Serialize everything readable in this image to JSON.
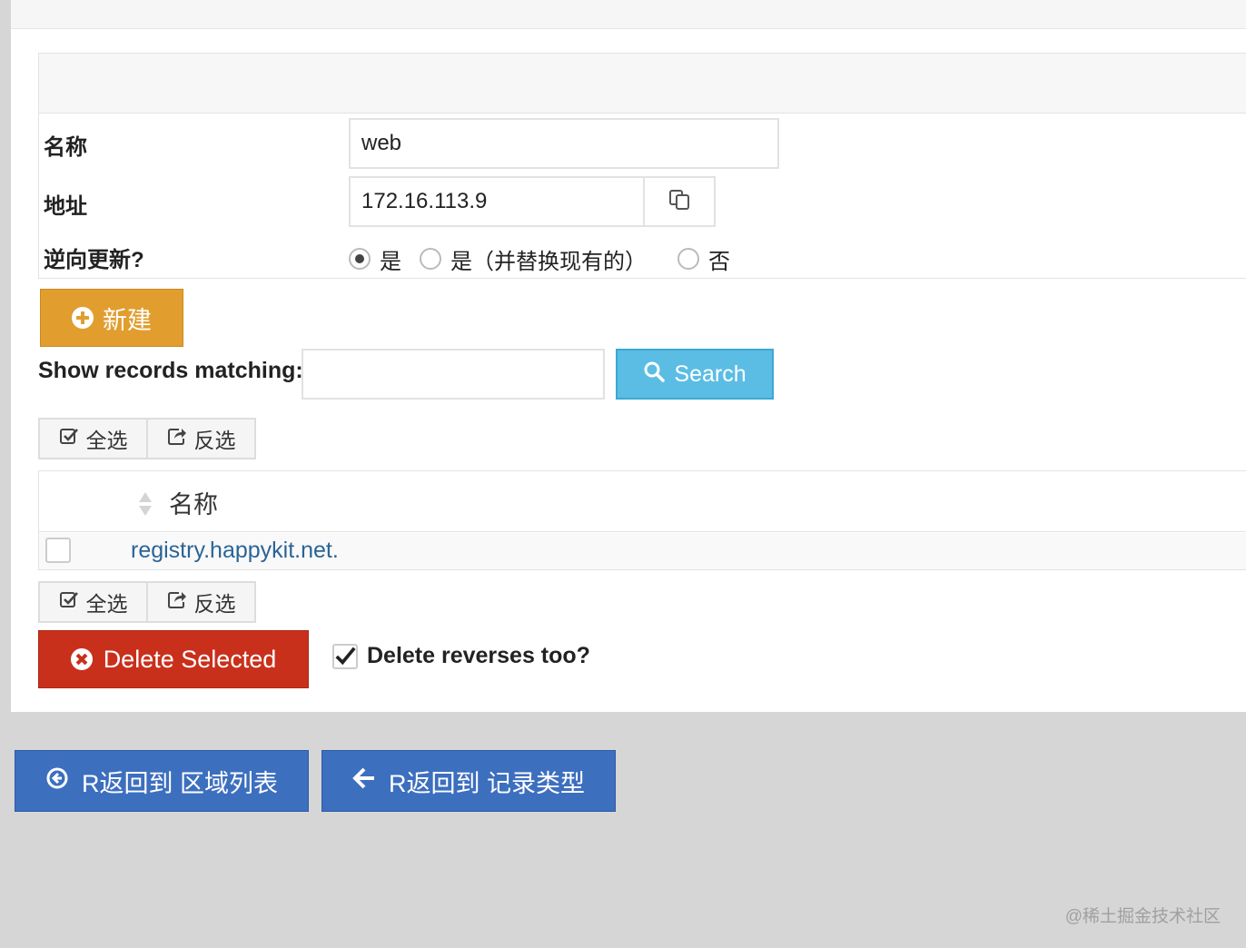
{
  "form": {
    "name_label": "名称",
    "name_value": "web",
    "address_label": "地址",
    "address_value": "172.16.113.9",
    "reverse_label": "逆向更新?",
    "reverse_options": [
      "是",
      "是（并替换现有的）",
      "否"
    ],
    "reverse_selected": "是"
  },
  "new_button": "新建",
  "search": {
    "label": "Show records matching:",
    "value": "",
    "button": "Search"
  },
  "selection": {
    "select_all": "全选",
    "invert": "反选"
  },
  "table": {
    "column_name": "名称",
    "rows": [
      {
        "name": "registry.happykit.net.",
        "checked": false
      }
    ]
  },
  "delete": {
    "button": "Delete Selected",
    "reverse_label": "Delete reverses too?",
    "reverse_checked": true
  },
  "nav": {
    "back_zone_list": "R返回到 区域列表",
    "back_record_types": "R返回到 记录类型"
  },
  "watermark": "@稀土掘金技术社区",
  "colors": {
    "new_button": "#e19e2e",
    "search_button": "#5bbde4",
    "delete_button": "#c9301c",
    "nav_button": "#3d6fbf",
    "link": "#2a6496"
  }
}
